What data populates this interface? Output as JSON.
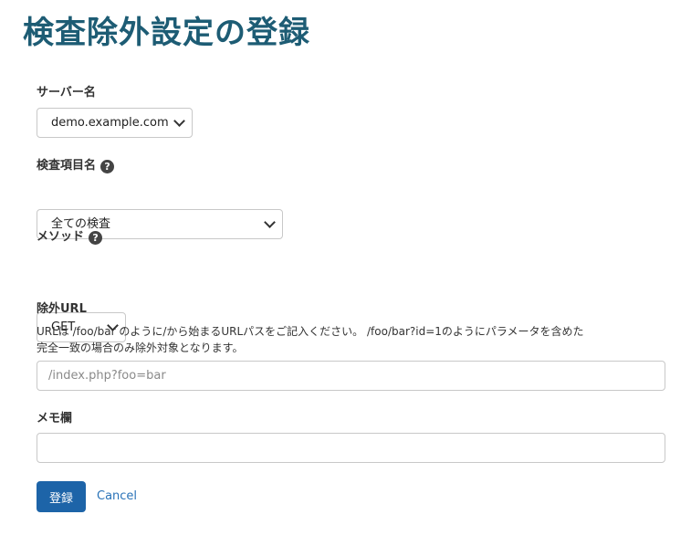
{
  "page": {
    "title": "検査除外設定の登録"
  },
  "form": {
    "server": {
      "label": "サーバー名",
      "selected": "demo.example.com"
    },
    "check_item": {
      "label": "検査項目名",
      "help_icon": "question-circle-icon",
      "selected": "全ての検査"
    },
    "method": {
      "label": "メソッド",
      "help_icon": "question-circle-icon",
      "selected": "GET"
    },
    "exclude_url": {
      "label": "除外URL",
      "help_line1": "URLは /foo/bar のように/から始まるURLパスをご記入ください。 /foo/bar?id=1のようにパラメータを含めた",
      "help_line2": "完全一致の場合のみ除外対象となります。",
      "placeholder": "/index.php?foo=bar",
      "value": ""
    },
    "memo": {
      "label": "メモ欄",
      "value": ""
    },
    "submit_label": "登録",
    "cancel_label": "Cancel"
  },
  "colors": {
    "title": "#1d5c74",
    "primary_button": "#1d64a8",
    "link": "#2a73b8"
  }
}
